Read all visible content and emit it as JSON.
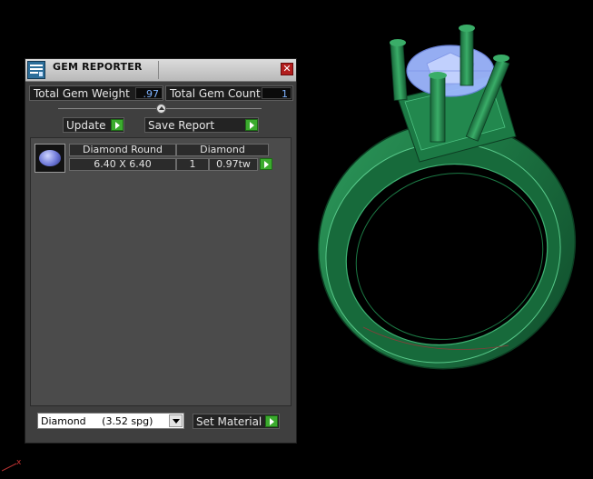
{
  "window": {
    "title": "GEM REPORTER",
    "close_glyph": "✕"
  },
  "stats": {
    "total_weight_label": "Total Gem Weight",
    "total_weight_value": ".97",
    "total_count_label": "Total Gem Count",
    "total_count_value": "1"
  },
  "actions": {
    "update_label": "Update",
    "save_report_label": "Save Report"
  },
  "gem_list": [
    {
      "cut_name": "Diamond Round",
      "size": "6.40 X 6.40",
      "material": "Diamond",
      "count": "1",
      "weight": "0.97tw"
    }
  ],
  "material": {
    "selected": "Diamond     (3.52 spg)",
    "set_label": "Set Material"
  },
  "colors": {
    "ring": "#1f7a46",
    "gem": "#9db7ff",
    "accent_green": "#3bab2e",
    "close_red": "#b21d1d"
  }
}
